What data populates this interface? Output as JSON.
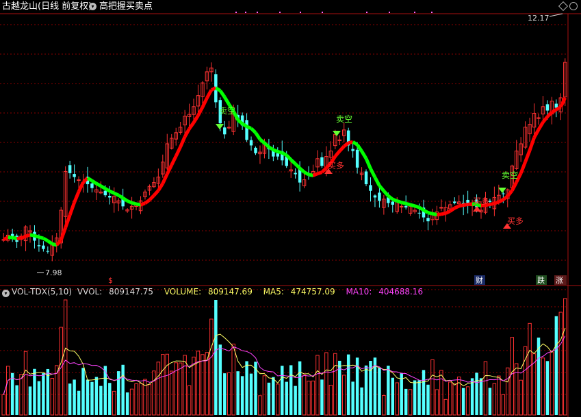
{
  "header": {
    "stock_name": "古越龙山",
    "period": "(日线 前复权)",
    "indicator_name": "高把握买卖点"
  },
  "volume_header": {
    "indicator": "VOL-TDX(5,10)",
    "vvol_label": "VVOL:",
    "vvol_value": "809147.75",
    "volume_label": "VOLUME:",
    "volume_value": "809147.69",
    "ma5_label": "MA5:",
    "ma5_value": "474757.09",
    "ma10_label": "MA10:",
    "ma10_value": "404688.16"
  },
  "colors": {
    "background": "#000000",
    "up": "#ff3232",
    "down": "#54ffff",
    "grid": "#8b0000",
    "line_green": "#00ff00",
    "line_red": "#ff0000",
    "ma5": "#ffff66",
    "ma10": "#ff44ff",
    "sell_label": "#66ff33",
    "buy_label": "#ff3333"
  },
  "markers": {
    "high_price": "12.17",
    "low_price": "7.98",
    "sell_labels": [
      "卖空",
      "卖空",
      "卖空"
    ],
    "buy_labels": [
      "买多",
      "买多",
      "买多"
    ],
    "bottom_labels": [
      "$",
      "财",
      "跌",
      "涨"
    ]
  },
  "chart_data": {
    "type": "candlestick",
    "price_range": [
      7.6,
      12.3
    ],
    "high": 12.17,
    "low": 7.98,
    "closes": [
      8.22,
      8.3,
      8.25,
      8.18,
      8.28,
      8.45,
      8.38,
      8.2,
      8.1,
      8.05,
      8.0,
      8.12,
      8.25,
      8.75,
      9.45,
      9.42,
      9.35,
      9.3,
      9.25,
      9.22,
      9.15,
      9.12,
      9.08,
      9.02,
      8.98,
      9.0,
      8.92,
      8.82,
      8.76,
      8.82,
      8.85,
      8.92,
      9.08,
      9.18,
      9.25,
      9.35,
      9.62,
      9.95,
      10.05,
      10.15,
      10.25,
      10.45,
      10.48,
      10.62,
      10.82,
      11.05,
      11.25,
      11.32,
      10.7,
      10.32,
      10.12,
      10.25,
      10.52,
      10.38,
      10.28,
      10.02,
      9.92,
      9.78,
      9.8,
      9.98,
      9.85,
      9.72,
      9.72,
      9.65,
      9.55,
      9.48,
      9.4,
      9.25,
      9.3,
      9.38,
      9.45,
      9.68,
      9.55,
      9.72,
      9.82,
      10.12,
      10.02,
      10.2,
      9.92,
      9.82,
      9.52,
      9.42,
      9.22,
      9.1,
      8.98,
      8.92,
      8.95,
      8.88,
      8.85,
      8.92,
      8.82,
      8.8,
      8.82,
      8.75,
      8.7,
      8.62,
      8.55,
      8.68,
      8.72,
      8.8,
      8.8,
      8.85,
      8.88,
      8.9,
      8.82,
      8.88,
      8.85,
      8.8,
      8.75,
      8.95,
      8.9,
      8.98,
      9.02,
      9.05,
      9.12,
      9.55,
      9.82,
      9.95,
      10.25,
      10.3,
      10.5,
      10.42,
      10.62,
      10.55,
      10.72,
      10.6,
      10.78,
      11.42
    ],
    "ylabel": ""
  }
}
